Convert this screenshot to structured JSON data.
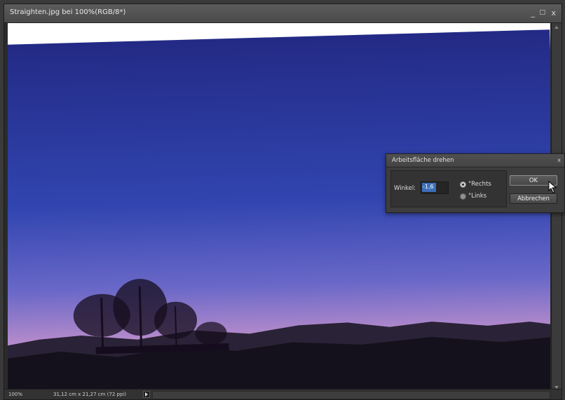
{
  "window": {
    "title": "Straighten.jpg bei 100%(RGB/8*)",
    "controls": {
      "minimize": "_",
      "maximize": "□",
      "close": "x"
    }
  },
  "status_bar": {
    "zoom": "100%",
    "doc_size": "31,12 cm x 21,27 cm (72 ppi)"
  },
  "dialog": {
    "title": "Arbeitsfläche drehen",
    "close": "x",
    "angle_label": "Winkel:",
    "angle_value": "-1,6",
    "direction_options": [
      {
        "label": "°Rechts",
        "selected": true
      },
      {
        "label": "°Links",
        "selected": false
      }
    ],
    "ok_label": "OK",
    "cancel_label": "Abbrechen"
  },
  "colors": {
    "sky_top": "#252c86",
    "sky_horizon": "#d8a6c8",
    "ui_dark": "#3a3a3a"
  }
}
